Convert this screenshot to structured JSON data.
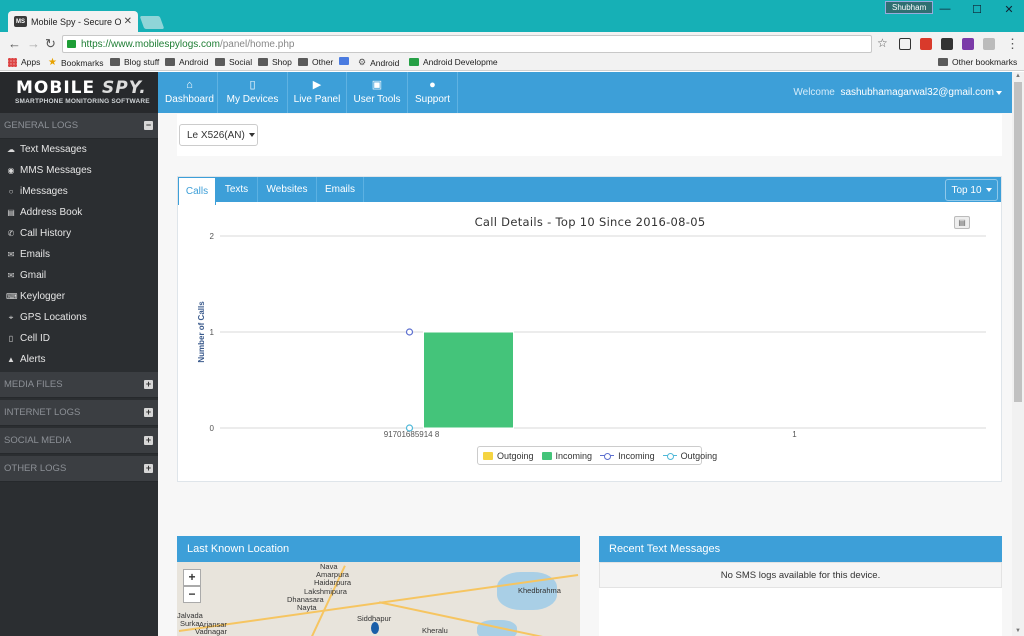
{
  "browser": {
    "tab_title": "Mobile Spy - Secure Onl",
    "tab_favicon": "MS",
    "user_chip": "Shubham",
    "url_secure": "https://www.mobilespylogs.com",
    "url_path": "/panel/home.php",
    "bookmarks": [
      "Apps",
      "Bookmarks",
      "Blog stuff",
      "Android",
      "Social",
      "Shop",
      "Other",
      "Android",
      "Android Developme",
      "Other bookmarks"
    ]
  },
  "header": {
    "logo": "MOBILE",
    "logo_accent": "SPY.",
    "logo_sub": "SMARTPHONE MONITORING SOFTWARE",
    "nav": [
      {
        "label": "Dashboard",
        "icon": "home-icon",
        "glyph": "⌂"
      },
      {
        "label": "My Devices",
        "icon": "phone-icon",
        "glyph": "▯"
      },
      {
        "label": "Live Panel",
        "icon": "play-icon",
        "glyph": "▶"
      },
      {
        "label": "User Tools",
        "icon": "briefcase-icon",
        "glyph": "▣"
      },
      {
        "label": "Support",
        "icon": "user-icon",
        "glyph": "●"
      }
    ],
    "welcome": "Welcome",
    "email": "sashubhamagarwal32@gmail.com"
  },
  "sidebar": {
    "general_logs": "GENERAL LOGS",
    "items": [
      {
        "label": "Text Messages",
        "glyph": "☁"
      },
      {
        "label": "MMS Messages",
        "glyph": "◉"
      },
      {
        "label": "iMessages",
        "glyph": "○"
      },
      {
        "label": "Address Book",
        "glyph": "▤"
      },
      {
        "label": "Call History",
        "glyph": "✆"
      },
      {
        "label": "Emails",
        "glyph": "✉"
      },
      {
        "label": "Gmail",
        "glyph": "✉"
      },
      {
        "label": "Keylogger",
        "glyph": "⌨"
      },
      {
        "label": "GPS Locations",
        "glyph": "⌖"
      },
      {
        "label": "Cell ID",
        "glyph": "▯"
      },
      {
        "label": "Alerts",
        "glyph": "▲"
      }
    ],
    "media_files": "MEDIA FILES",
    "internet_logs": "INTERNET LOGS",
    "social_media": "SOCIAL MEDIA",
    "other_logs": "OTHER LOGS"
  },
  "device": {
    "selected": "Le X526(AN)"
  },
  "tabs": [
    "Calls",
    "Texts",
    "Websites",
    "Emails"
  ],
  "top_button": "Top 10",
  "chart_data": {
    "type": "bar",
    "title": "Call Details - Top 10 Since 2016-08-05",
    "ylabel": "Number of Calls",
    "ylim": [
      0,
      2
    ],
    "yticks": [
      "0",
      "1",
      "2"
    ],
    "categories": [
      "91701685914 8",
      "1"
    ],
    "series": [
      {
        "name": "Outgoing",
        "kind": "bar",
        "color": "#f5d442",
        "values": [
          0,
          0
        ]
      },
      {
        "name": "Incoming",
        "kind": "bar",
        "color": "#44c47a",
        "values": [
          1,
          0
        ]
      },
      {
        "name": "Incoming",
        "kind": "line",
        "color": "#5c6fcf",
        "values": [
          1,
          null
        ]
      },
      {
        "name": "Outgoing",
        "kind": "line",
        "color": "#4fb8d8",
        "values": [
          0,
          null
        ]
      }
    ],
    "legend": "bottom-center"
  },
  "location": {
    "title": "Last Known Location",
    "zoom_in": "+",
    "zoom_out": "−"
  },
  "map_labels": [
    "Nava",
    "Amarpura",
    "Haidarpura",
    "Lakshmipura",
    "Dhanasara",
    "Nayta",
    "Siddhapur",
    "Kheralu",
    "Khedbrahma",
    "Jalvada",
    "Surka",
    "Arjansar",
    "Vadnagar"
  ],
  "sms": {
    "title": "Recent Text Messages",
    "empty": "No SMS logs available for this device."
  }
}
